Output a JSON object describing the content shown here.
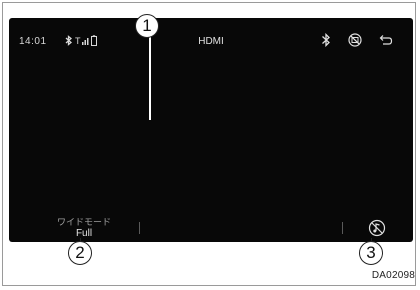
{
  "status_bar": {
    "time": "14:01",
    "source_title": "HDMI",
    "icons": [
      "bluetooth-connected-icon",
      "signal-strength-icon",
      "phone-battery-icon"
    ],
    "right_icons": [
      "bluetooth-icon",
      "screen-off-icon",
      "back-icon"
    ]
  },
  "bottom_bar": {
    "wide_mode_label": "ワイドモード",
    "wide_mode_value": "Full",
    "sound_button_icon": "sound-settings-icon"
  },
  "callouts": {
    "c1": "1",
    "c2": "2",
    "c3": "3"
  },
  "figure_code": "DA02098",
  "colors": {
    "screen_bg": "#080808",
    "text_primary": "#e4e4e4",
    "text_secondary": "#a0a0a0"
  }
}
